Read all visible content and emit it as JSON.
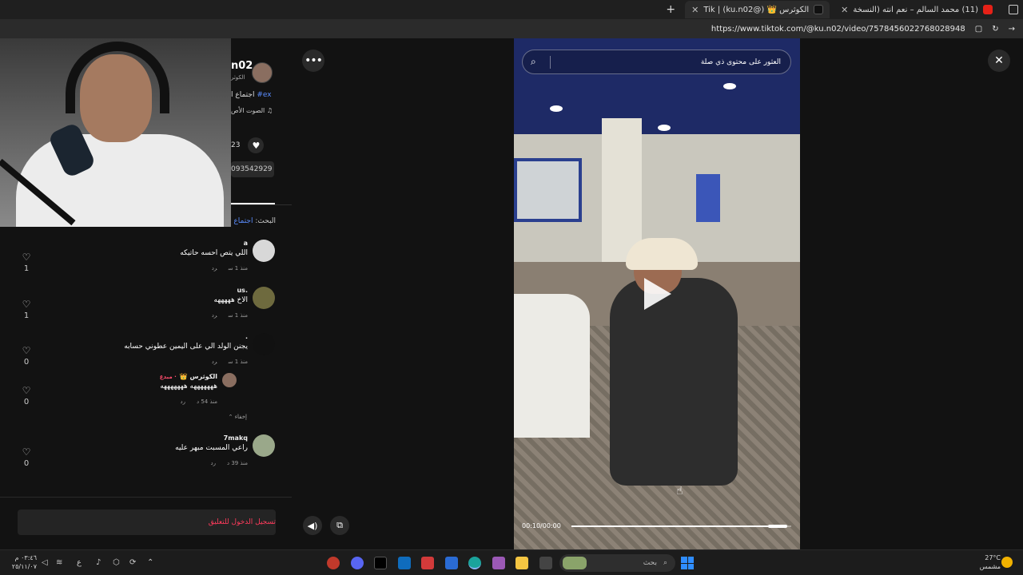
{
  "browser": {
    "tabs": [
      {
        "label": "(11) محمد السالم – نعم انته (النسخة",
        "favicon": "youtube"
      },
      {
        "label": "الكوثرس 👑 (@ku.n02) | Tik",
        "favicon": "tiktok",
        "active": true
      }
    ],
    "new_tab": "+",
    "close_glyph": "✕",
    "url": "https://www.tiktok.com/@ku.n02/video/7578456022768028948"
  },
  "author": {
    "name_fragment": "n02",
    "sub_fragment": "الكوثر",
    "hashtag_prefix": "#ex",
    "hashtag_text": "اجتماع ا",
    "music": "الصوت الأص",
    "likes": "23",
    "link_fragment": "093542929"
  },
  "related_search": {
    "prefix": "البحث:",
    "query": "اجتماع ا"
  },
  "comments": [
    {
      "user": "a",
      "text": "اللي يتص احسه حاتيكه",
      "time": "منذ 1 س",
      "reply": "رد",
      "likes": "1",
      "avatar_color": "#d8d8d8"
    },
    {
      "user": ".us",
      "text": "الاخ هههههه",
      "time": "منذ 1 س",
      "reply": "رد",
      "likes": "1",
      "avatar_color": "#6e6a3e"
    },
    {
      "user": ".",
      "text": "يجنن الولد الي على اليمين عطوني حسابه",
      "time": "منذ 1 س",
      "reply": "رد",
      "likes": "0",
      "avatar_color": "#111111"
    },
    {
      "user": "الكوثرس 👑",
      "creator_badge": "· مبدع",
      "text": "هههههههه هههههههه",
      "time": "منذ 54 د",
      "reply": "رد",
      "likes": "0",
      "avatar_color": "#8a6e60"
    },
    {
      "user": "7makq",
      "text": "راعي المسبت مبهر عليه",
      "time": "منذ 39 د",
      "reply": "رد",
      "likes": "0",
      "avatar_color": "#9aa88a"
    }
  ],
  "hide_label": "إخفاء",
  "login_prompt": "تسجيل الدخول للتعليق",
  "player": {
    "search_placeholder": "العثور على محتوى ذي صلة",
    "time": "00:10/00:00",
    "progress": 0.98
  },
  "taskbar": {
    "search_label": "بحث",
    "weather_temp": "27°C",
    "weather_desc": "مشمس",
    "clock_time": "٠٣:٤٦ م",
    "clock_date": "٢٥/١١/٠٧"
  }
}
